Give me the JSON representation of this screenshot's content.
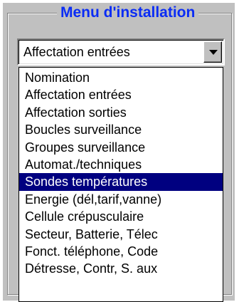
{
  "window": {
    "title": "Menu d'installation"
  },
  "combo": {
    "value": "Affectation entrées",
    "button_icon": "chevron-down-icon"
  },
  "dropdown": {
    "selected_index": 6,
    "items": [
      {
        "label": "Nomination"
      },
      {
        "label": "Affectation entrées"
      },
      {
        "label": "Affectation sorties"
      },
      {
        "label": "Boucles surveillance"
      },
      {
        "label": "Groupes surveillance"
      },
      {
        "label": "Automat./techniques"
      },
      {
        "label": "Sondes températures"
      },
      {
        "label": "Energie (dél,tarif,vanne)"
      },
      {
        "label": "Cellule crépusculaire"
      },
      {
        "label": "Secteur, Batterie, Télec"
      },
      {
        "label": "Fonct. téléphone, Code"
      },
      {
        "label": "Détresse, Contr, S. aux"
      }
    ]
  },
  "colors": {
    "title": "#0a2cf5",
    "selection_bg": "#000080",
    "selection_fg": "#ffffff",
    "panel": "#c0c0c0"
  }
}
